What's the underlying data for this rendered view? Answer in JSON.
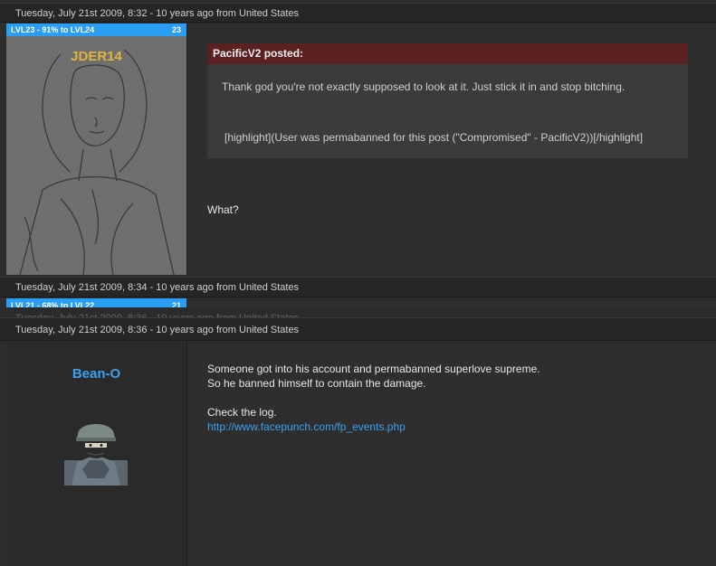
{
  "posts": [
    {
      "timestamp": "Tuesday, July 21st 2009, 8:32 - 10 years ago from United States",
      "level_label": "LVL23 - 91% to LVL24",
      "level_number": "23",
      "username": "JDER14",
      "quote": {
        "author_line": "PacificV2 posted:",
        "line1": "Thank god you're not exactly supposed to look at it. Just stick it in and stop bitching.",
        "line2": "[highlight](User was permabanned for this post (\"Compromised\" - PacificV2))[/highlight]"
      },
      "message": "What?"
    },
    {
      "timestamp": "Tuesday, July 21st 2009, 8:34 - 10 years ago from United States",
      "level_label": "LVL21 - 68% to LVL22",
      "level_number": "21"
    },
    {
      "timestamp": "Tuesday, July 21st 2009, 8:36 - 10 years ago from United States",
      "username": "Bean-O",
      "message_lines": [
        "Someone got into his account and permabanned superlove supreme.",
        "So he banned himself to contain the damage.",
        "Check the log."
      ],
      "link": "http://www.facepunch.com/fp_events.php"
    }
  ],
  "colors": {
    "level_bar": "#2a9df4",
    "quote_header": "#5b2020",
    "username_gold": "#e2b53c",
    "username_blue": "#3da0ee",
    "link": "#3da0ee"
  }
}
